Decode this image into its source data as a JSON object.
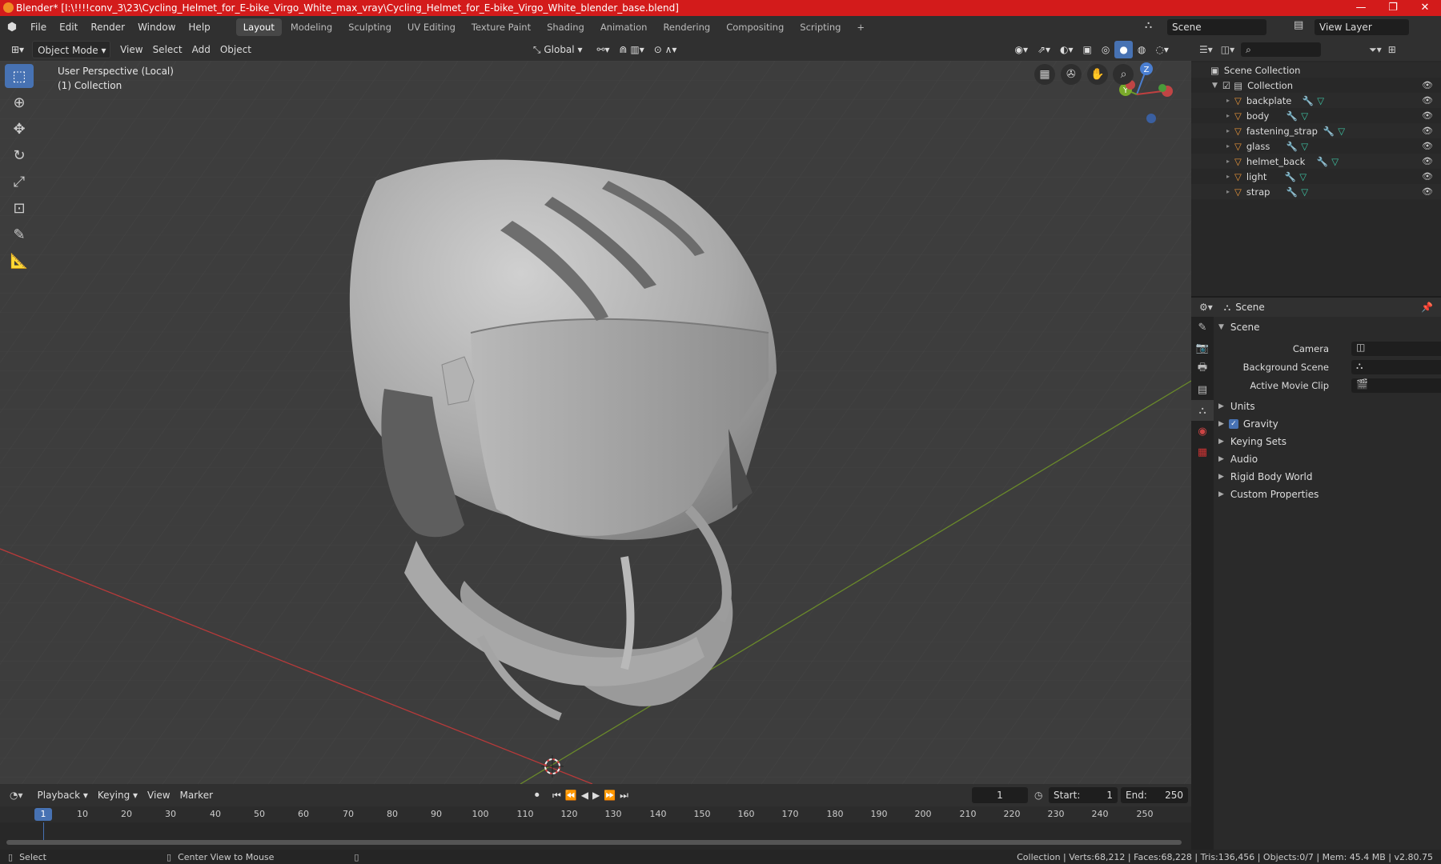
{
  "window": {
    "title": "Blender* [I:\\!!!!conv_3\\23\\Cycling_Helmet_for_E-bike_Virgo_White_max_vray\\Cycling_Helmet_for_E-bike_Virgo_White_blender_base.blend]",
    "minimize": "—",
    "maximize": "❐",
    "close": "✕"
  },
  "menu": {
    "items": [
      "File",
      "Edit",
      "Render",
      "Window",
      "Help"
    ],
    "workspaces": [
      "Layout",
      "Modeling",
      "Sculpting",
      "UV Editing",
      "Texture Paint",
      "Shading",
      "Animation",
      "Rendering",
      "Compositing",
      "Scripting"
    ],
    "add_tab": "+",
    "scene_name": "Scene",
    "view_layer": "View Layer"
  },
  "viewport_header": {
    "mode": "Object Mode",
    "items": [
      "View",
      "Select",
      "Add",
      "Object"
    ],
    "orientation": "Global"
  },
  "viewport": {
    "perspective": "User Perspective (Local)",
    "collection": "(1) Collection",
    "gizmo": {
      "z": "Z",
      "y": "Y"
    }
  },
  "outliner": {
    "root": "Scene Collection",
    "collection": "Collection",
    "objects": [
      "backplate",
      "body",
      "fastening_strap",
      "glass",
      "helmet_back",
      "light",
      "strap"
    ]
  },
  "properties": {
    "header": "Scene",
    "section": "Scene",
    "fields": [
      {
        "label": "Camera"
      },
      {
        "label": "Background Scene"
      },
      {
        "label": "Active Movie Clip"
      }
    ],
    "panels": [
      "Units",
      "Gravity",
      "Keying Sets",
      "Audio",
      "Rigid Body World",
      "Custom Properties"
    ],
    "gravity_checked": true
  },
  "timeline": {
    "menus": [
      "Playback",
      "Keying",
      "View",
      "Marker"
    ],
    "current_frame": "1",
    "start_label": "Start:",
    "start": "1",
    "end_label": "End:",
    "end": "250",
    "ticks": [
      "1",
      "10",
      "20",
      "30",
      "40",
      "50",
      "60",
      "70",
      "80",
      "90",
      "100",
      "110",
      "120",
      "130",
      "140",
      "150",
      "160",
      "170",
      "180",
      "190",
      "200",
      "210",
      "220",
      "230",
      "240",
      "250"
    ]
  },
  "statusbar": {
    "select": "Select",
    "center": "Center View to Mouse",
    "stats": "Collection | Verts:68,212 | Faces:68,228 | Tris:136,456 | Objects:0/7 | Mem: 45.4 MB | v2.80.75"
  },
  "colors": {
    "title_bar": "#d31b1b",
    "accent": "#4772b3",
    "x_axis": "#b83a3a",
    "y_axis": "#6a8a2a",
    "object_icon": "#e8953a",
    "modifier_icon": "#6b9bd8",
    "mesh_icon": "#3ec3a3"
  }
}
